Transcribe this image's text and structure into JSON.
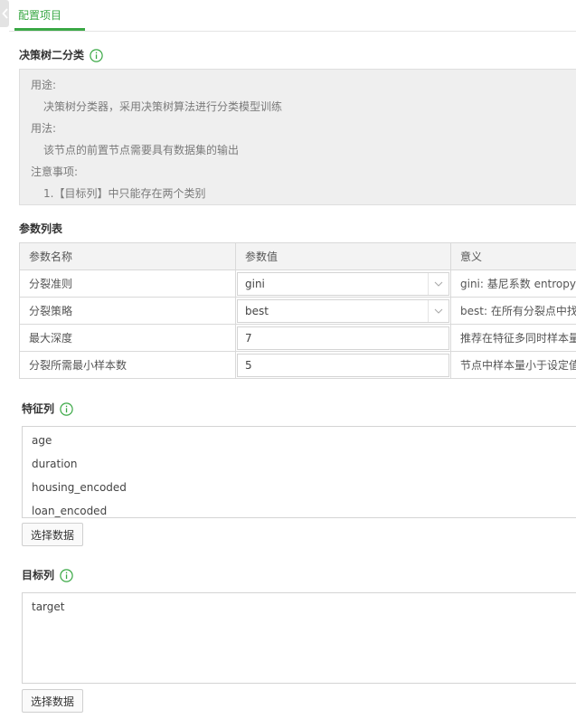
{
  "tabs": [
    {
      "label": "配置项目",
      "active": true
    }
  ],
  "accent_color": "#3aa845",
  "node": {
    "title": "决策树二分类",
    "description": {
      "usage_label": "用途:",
      "usage_text": "决策树分类器，采用决策树算法进行分类模型训练",
      "method_label": "用法:",
      "method_text": "该节点的前置节点需要具有数据集的输出",
      "notes_label": "注意事项:",
      "notes_item": "1.【目标列】中只能存在两个类别"
    }
  },
  "params": {
    "title": "参数列表",
    "headers": [
      "参数名称",
      "参数值",
      "意义"
    ],
    "rows": [
      {
        "name": "分裂准则",
        "value": "gini",
        "control": "select",
        "meaning": "gini: 基尼系数 entropy: 信"
      },
      {
        "name": "分裂策略",
        "value": "best",
        "control": "select",
        "meaning": "best: 在所有分裂点中找到"
      },
      {
        "name": "最大深度",
        "value": "7",
        "control": "input",
        "meaning": "推荐在特征多同时样本量"
      },
      {
        "name": "分裂所需最小样本数",
        "value": "5",
        "control": "input",
        "meaning": "节点中样本量小于设定值"
      }
    ]
  },
  "feature_columns": {
    "title": "特征列",
    "items": [
      "age",
      "duration",
      "housing_encoded",
      "loan_encoded"
    ],
    "button": "选择数据"
  },
  "target_column": {
    "title": "目标列",
    "items": [
      "target"
    ],
    "button": "选择数据"
  },
  "icons": {
    "info": "info-circle-icon",
    "collapse": "chevron-left-icon",
    "dropdown": "chevron-down-icon"
  }
}
